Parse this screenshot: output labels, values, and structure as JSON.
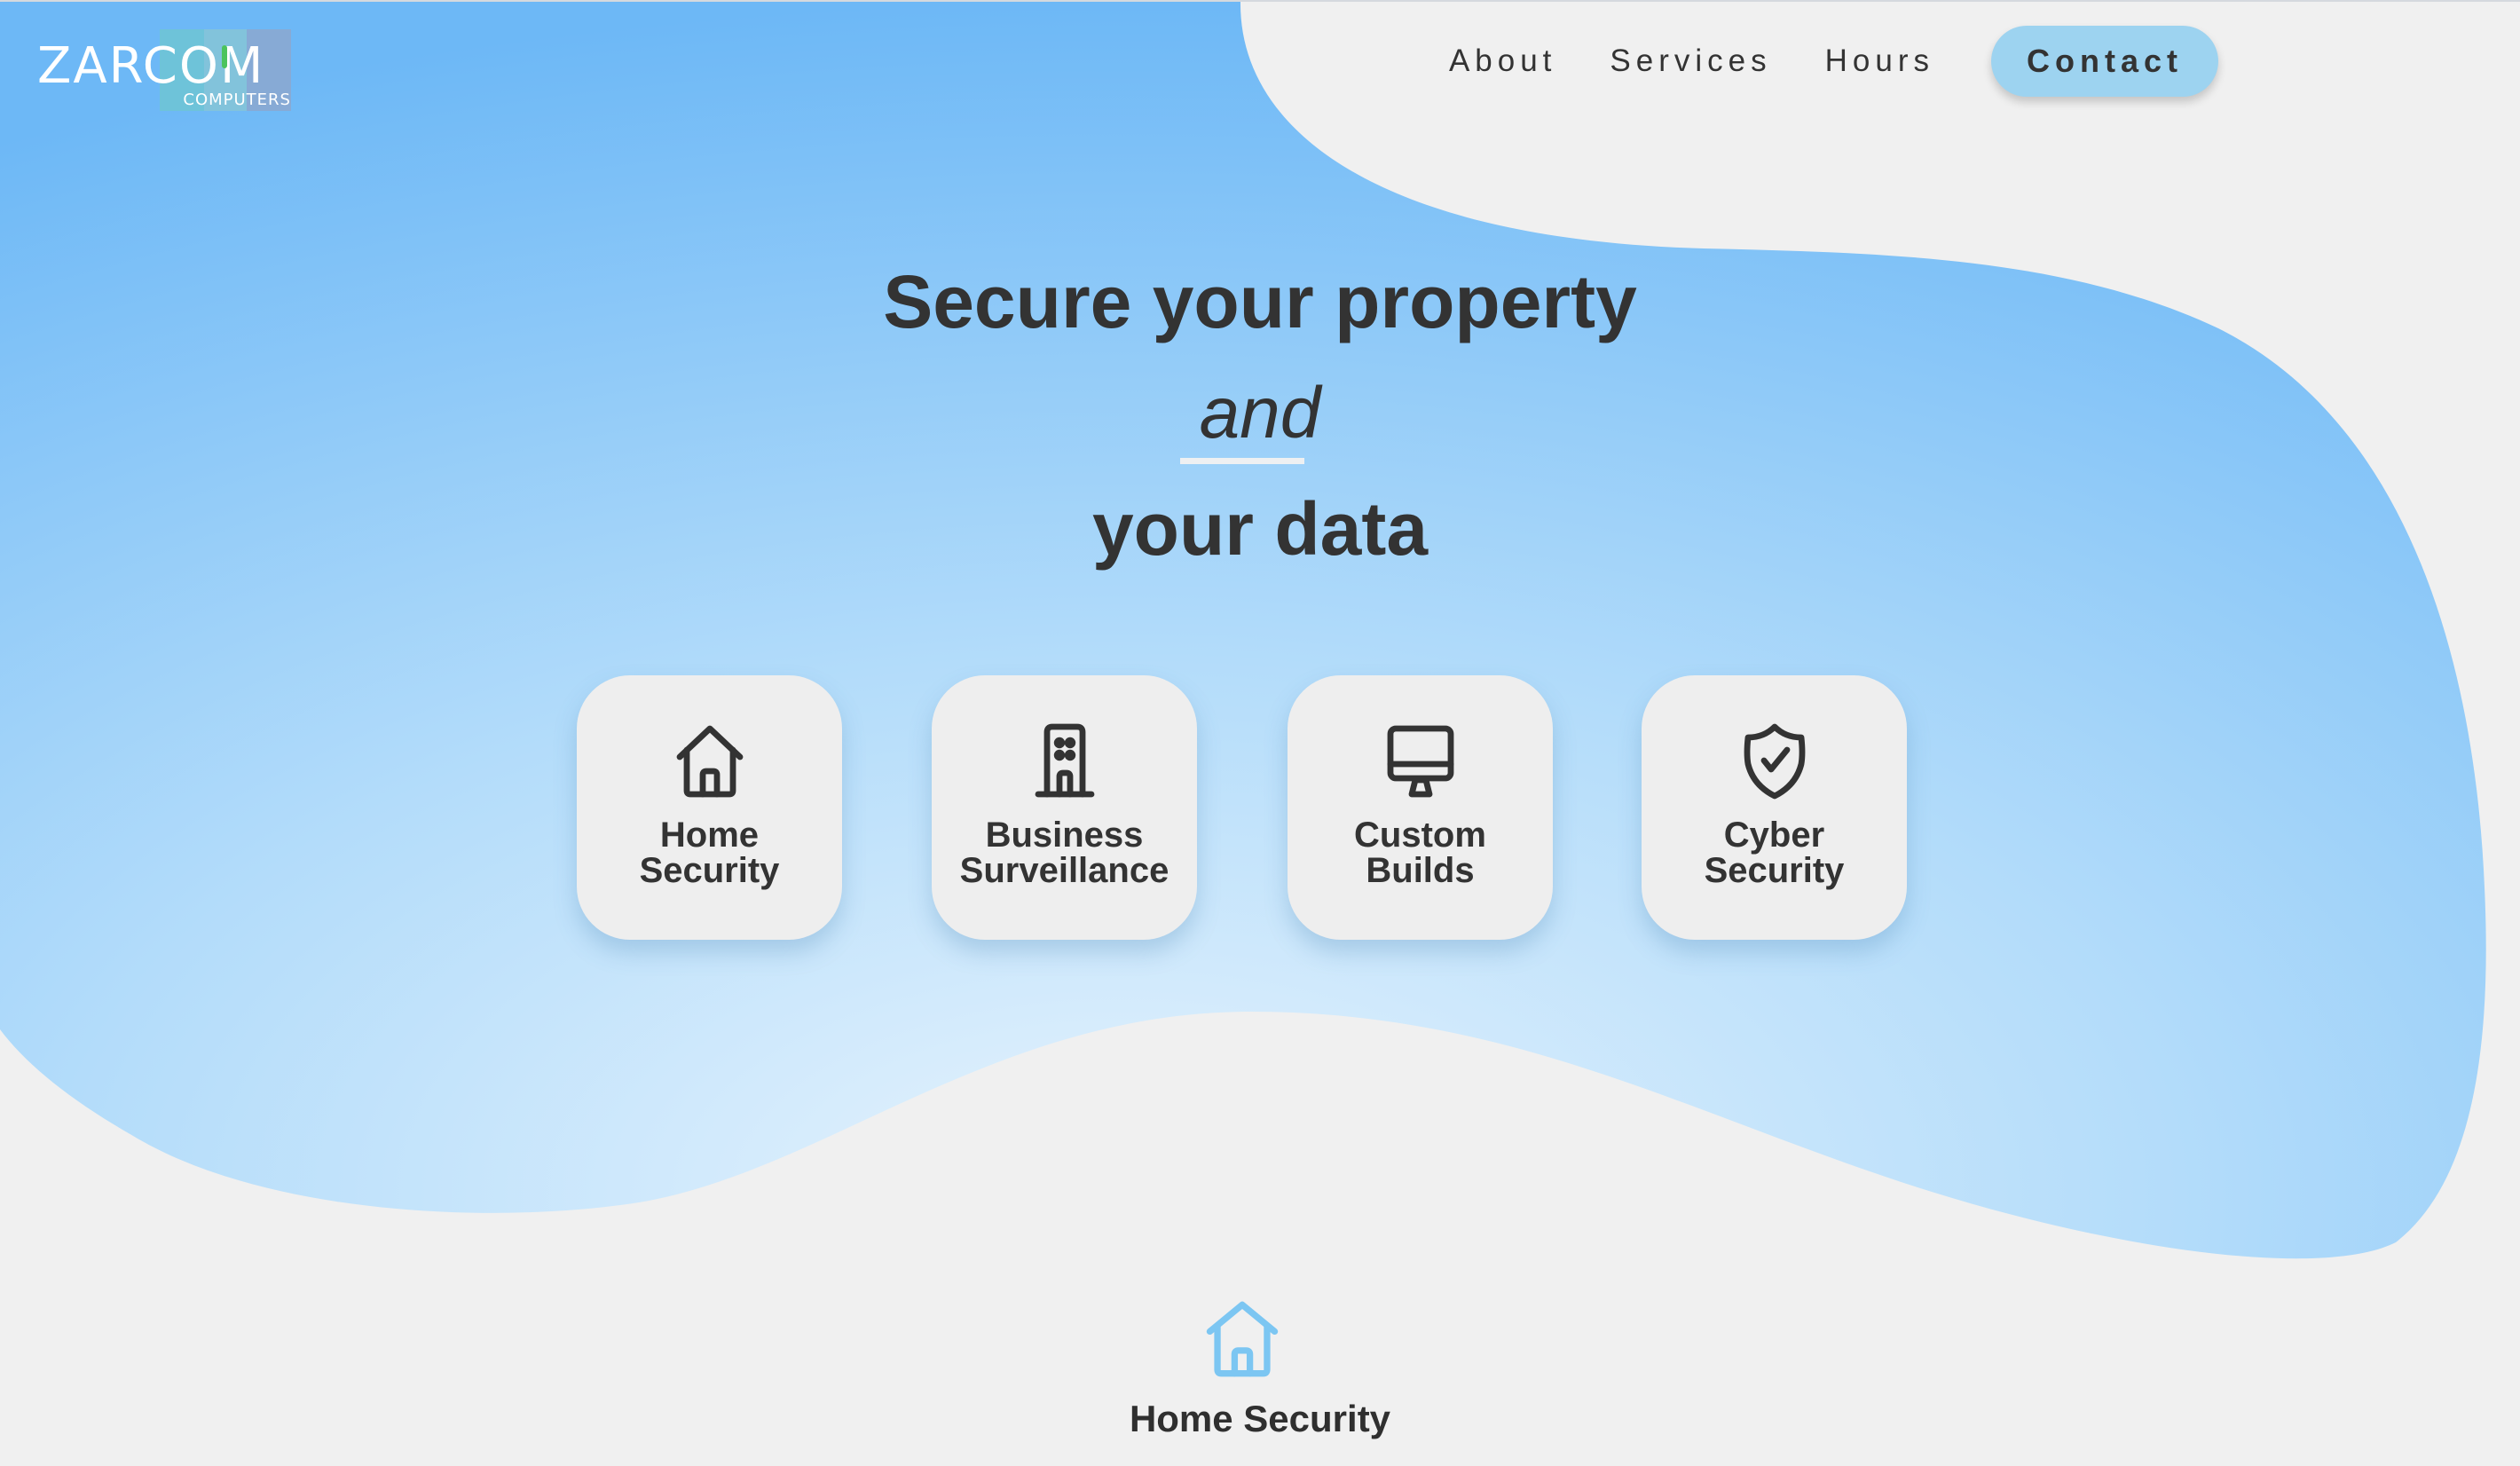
{
  "brand": {
    "name": "ZARCOM",
    "tagline": "COMPUTERS"
  },
  "nav": {
    "items": [
      {
        "label": "About"
      },
      {
        "label": "Services"
      },
      {
        "label": "Hours"
      }
    ],
    "contact_label": "Contact"
  },
  "hero": {
    "line1": "Secure your property",
    "line2": "and",
    "line3": "your data"
  },
  "services": [
    {
      "label_line1": "Home",
      "label_line2": "Security",
      "icon": "house-icon"
    },
    {
      "label_line1": "Business",
      "label_line2": "Surveillance",
      "icon": "building-icon"
    },
    {
      "label_line1": "Custom",
      "label_line2": "Builds",
      "icon": "monitor-icon"
    },
    {
      "label_line1": "Cyber",
      "label_line2": "Security",
      "icon": "shield-check-icon"
    }
  ],
  "section": {
    "title": "Home Security",
    "icon": "house-icon"
  },
  "colors": {
    "accent": "#9dd3f0",
    "blob_dark": "#6fbaf7",
    "blob_light": "#e3f1fd",
    "text": "#333333",
    "background": "#f0f0f0",
    "section_icon": "#7cc6f2"
  }
}
